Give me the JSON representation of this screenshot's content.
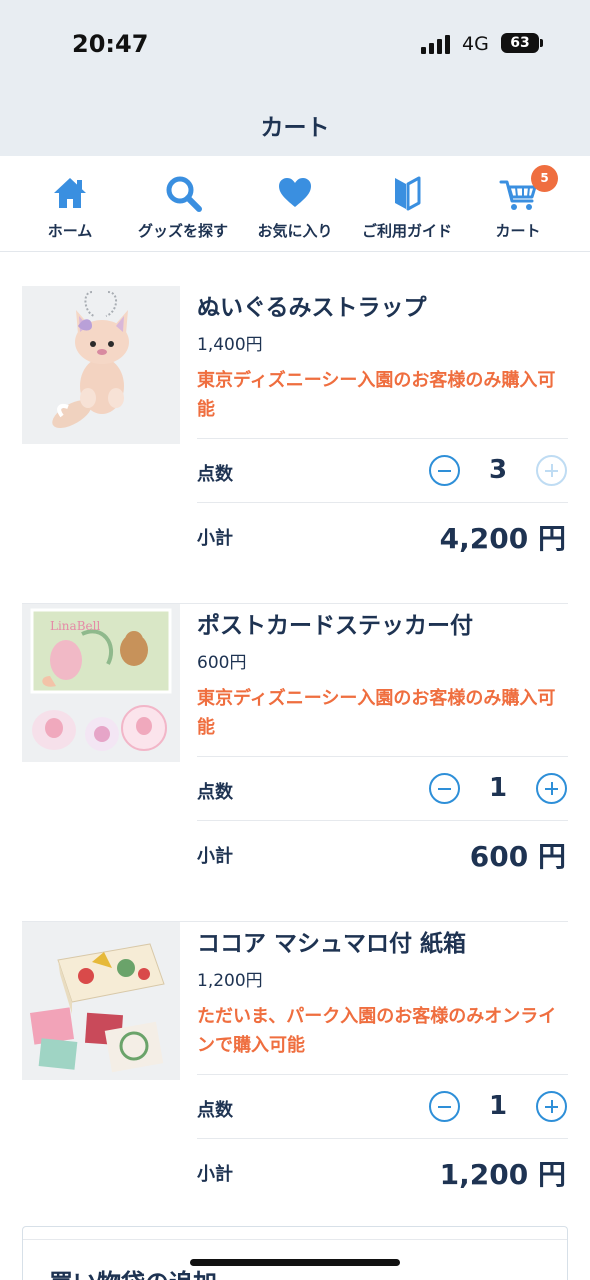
{
  "status_bar": {
    "time": "20:47",
    "network": "4G",
    "battery": "63"
  },
  "header": {
    "title": "カート"
  },
  "nav": [
    {
      "label": "ホーム",
      "icon": "home-icon"
    },
    {
      "label": "グッズを探す",
      "icon": "search-icon"
    },
    {
      "label": "お気に入り",
      "icon": "heart-icon"
    },
    {
      "label": "ご利用ガイド",
      "icon": "guide-icon"
    },
    {
      "label": "カート",
      "icon": "cart-icon",
      "badge": "5"
    }
  ],
  "cart": {
    "qty_label": "点数",
    "subtotal_label": "小計",
    "items": [
      {
        "name": "ぬいぐるみストラップ",
        "price": "1,400円",
        "note": "東京ディズニーシー入園のお客様のみ購入可能",
        "qty": "3",
        "subtotal": "4,200 円",
        "plus_enabled": false
      },
      {
        "name": "ポストカードステッカー付",
        "price": "600円",
        "note": "東京ディズニーシー入園のお客様のみ購入可能",
        "qty": "1",
        "subtotal": "600 円",
        "plus_enabled": true
      },
      {
        "name": "ココア マシュマロ付 紙箱",
        "price": "1,200円",
        "note": "ただいま、パーク入園のお客様のみオンラインで購入可能",
        "qty": "1",
        "subtotal": "1,200 円",
        "plus_enabled": true
      }
    ]
  },
  "bag_section": {
    "title": "買い物袋の追加"
  },
  "colors": {
    "accent": "#2e8fd8",
    "warning": "#ef6e3f",
    "text": "#1e3352",
    "header_bg": "#e8edf2"
  }
}
